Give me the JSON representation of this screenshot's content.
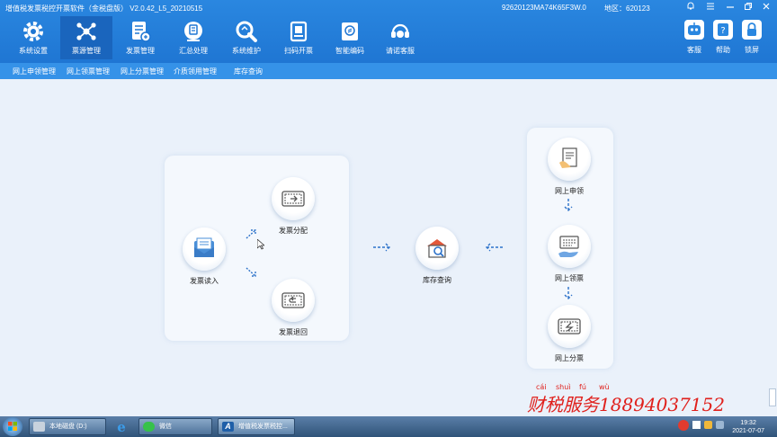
{
  "window": {
    "title": "增值税发票税控开票软件（金税盘版） V2.0.42_L5_20210515",
    "tax_id": "92620123MA74K65F3W.0",
    "region": "地区：620123"
  },
  "nav": {
    "items": [
      {
        "label": "系统设置",
        "icon": "gear-icon"
      },
      {
        "label": "票源管理",
        "icon": "network-icon"
      },
      {
        "label": "发票管理",
        "icon": "invoice-icon"
      },
      {
        "label": "汇总处理",
        "icon": "summary-icon"
      },
      {
        "label": "系统维护",
        "icon": "wrench-icon"
      },
      {
        "label": "扫码开票",
        "icon": "scan-icon"
      },
      {
        "label": "智能编码",
        "icon": "code-book-icon"
      },
      {
        "label": "请诺客服",
        "icon": "service-icon"
      }
    ],
    "active_index": 1,
    "right_tools": [
      {
        "label": "客服",
        "icon": "robot-icon"
      },
      {
        "label": "帮助",
        "icon": "help-icon"
      },
      {
        "label": "锁屏",
        "icon": "lock-icon"
      }
    ]
  },
  "subnav": {
    "items": [
      "网上申领管理",
      "网上领票管理",
      "网上分票管理",
      "介质领用管理",
      "库存查询"
    ]
  },
  "flow": {
    "read_in": "发票读入",
    "distribute": "发票分配",
    "return": "发票退回",
    "inventory": "库存查询",
    "apply_online": "网上申领",
    "receive_online": "网上领票",
    "split_online": "网上分票"
  },
  "watermark": {
    "pinyin": [
      "cái",
      "shuì",
      "fú",
      "wù"
    ],
    "text": "财税服务18894037152"
  },
  "taskbar": {
    "drive": "本地磁盘 (D:)",
    "wechat": "微信",
    "app": "增值税发票税控...",
    "time": "19:32",
    "date": "2021-07-07"
  },
  "colors": {
    "header": "#2a87e0",
    "active_tab": "#1a65bd",
    "subnav": "#3592e8",
    "background": "#eaf1fa",
    "arrow": "#2d72c9",
    "watermark": "#e0201c"
  }
}
